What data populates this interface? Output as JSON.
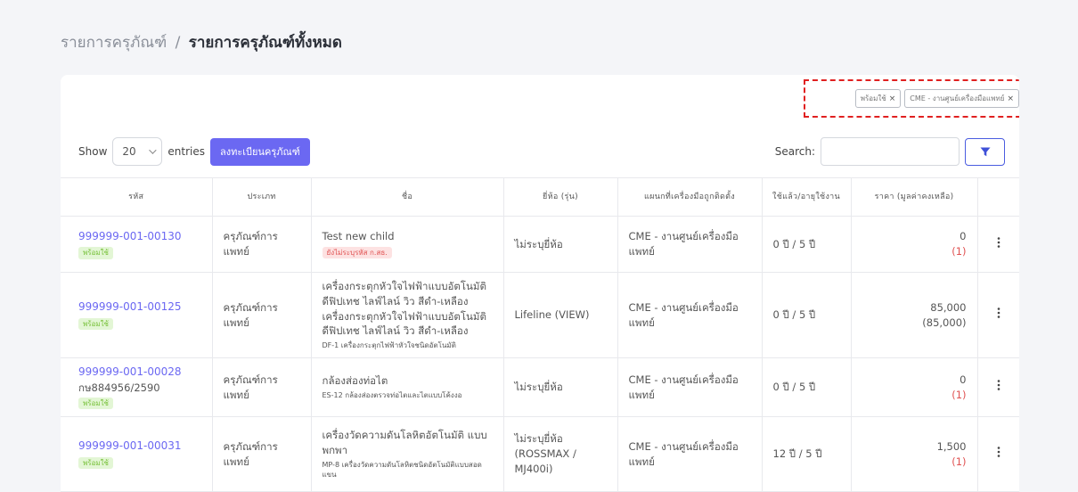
{
  "breadcrumb": {
    "parent": "รายการครุภัณฑ์",
    "separator": "/",
    "current": "รายการครุภัณฑ์ทั้งหมด"
  },
  "filters": [
    {
      "label": "พร้อมใช้",
      "remove": "×"
    },
    {
      "label": "CME - งานศูนย์เครื่องมือแพทย์",
      "remove": "×"
    }
  ],
  "controls": {
    "show_label": "Show",
    "entries_value": "20",
    "entries_label": "entries",
    "register_button": "ลงทะเบียนครุภัณฑ์",
    "search_label": "Search:",
    "search_value": ""
  },
  "table": {
    "headers": [
      "รหัส",
      "ประเภท",
      "ชื่อ",
      "ยี่ห้อ (รุ่น)",
      "แผนกที่เครื่องมือถูกติดตั้ง",
      "ใช้แล้ว/อายุใช้งาน",
      "ราคา (มูลค่าคงเหลือ)",
      ""
    ],
    "rows": [
      {
        "code": "999999-001-00130",
        "reg": "",
        "status": "พร้อมใช้",
        "type": "ครุภัณฑ์การแพทย์",
        "name": "Test new child",
        "name_sub": "",
        "name_badge": "ยังไม่ระบุรหัส ก.สธ.",
        "brand": "ไม่ระบุยี่ห้อ",
        "dept": "CME - งานศูนย์เครื่องมือแพทย์",
        "age": "0 ปี / 5 ปี",
        "price": "0",
        "residual": "(1)",
        "residual_negative": true
      },
      {
        "code": "999999-001-00125",
        "reg": "",
        "status": "พร้อมใช้",
        "type": "ครุภัณฑ์การแพทย์",
        "name": "เครื่องกระตุกหัวใจไฟฟ้าแบบอัตโนมัติดีฟิปเทช ไลฟ์ไลน์ วิว สีดำ-เหลือง เครื่องกระตุกหัวใจไฟฟ้าแบบอัตโนมัติดีฟิปเทช ไลฟ์ไลน์ วิว สีดำ-เหลือง",
        "name_sub": "DF-1 เครื่องกระตุกไฟฟ้าหัวใจชนิดอัตโนมัติ",
        "name_badge": "",
        "brand": "Lifeline (VIEW)",
        "dept": "CME - งานศูนย์เครื่องมือแพทย์",
        "age": "0 ปี / 5 ปี",
        "price": "85,000",
        "residual": "(85,000)",
        "residual_negative": false
      },
      {
        "code": "999999-001-00028",
        "reg": "กษ884956/2590",
        "status": "พร้อมใช้",
        "type": "ครุภัณฑ์การแพทย์",
        "name": "กล้องส่องท่อไต",
        "name_sub": "ES-12 กล้องส่องตรวจท่อไตและไตแบบโค้งงอ",
        "name_badge": "",
        "brand": "ไม่ระบุยี่ห้อ",
        "dept": "CME - งานศูนย์เครื่องมือแพทย์",
        "age": "0 ปี / 5 ปี",
        "price": "0",
        "residual": "(1)",
        "residual_negative": true
      },
      {
        "code": "999999-001-00031",
        "reg": "",
        "status": "พร้อมใช้",
        "type": "ครุภัณฑ์การแพทย์",
        "name": "เครื่องวัดความดันโลหิตอัตโนมัติ แบบพกพา",
        "name_sub": "MP-8 เครื่องวัดความดันโลหิตชนิดอัตโนมัติแบบสอดแขน",
        "name_badge": "",
        "brand": "ไม่ระบุยี่ห้อ (ROSSMAX / MJ400i)",
        "dept": "CME - งานศูนย์เครื่องมือแพทย์",
        "age": "12 ปี / 5 ปี",
        "price": "1,500",
        "residual": "(1)",
        "residual_negative": true
      }
    ]
  },
  "colors": {
    "primary": "#6b68f2",
    "ready_bg": "#e3f6d5",
    "ready_text": "#78c13a",
    "danger": "#e05252",
    "highlight": "#e02020"
  },
  "icons": {
    "filter": "filter-funnel-icon",
    "more": "kebab-menu-icon",
    "dropdown": "chevron-down-icon",
    "remove": "close-icon"
  }
}
